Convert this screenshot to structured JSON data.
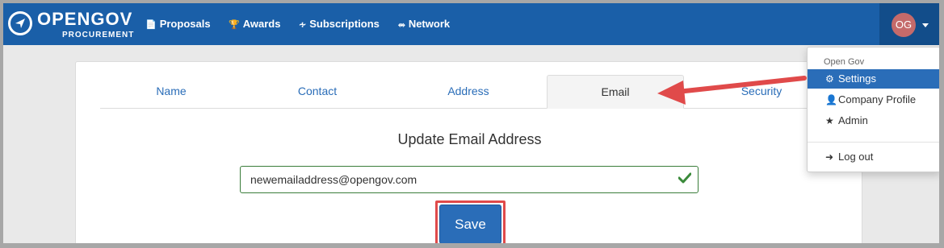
{
  "brand": {
    "title": "OPENGOV",
    "subtitle": "PROCUREMENT"
  },
  "nav": {
    "items": [
      {
        "label": "Proposals",
        "icon": "document-icon"
      },
      {
        "label": "Awards",
        "icon": "trophy-icon"
      },
      {
        "label": "Subscriptions",
        "icon": "rss-icon"
      },
      {
        "label": "Network",
        "icon": "share-icon"
      }
    ]
  },
  "user": {
    "initials": "OG"
  },
  "tabs": [
    {
      "label": "Name"
    },
    {
      "label": "Contact"
    },
    {
      "label": "Address"
    },
    {
      "label": "Email",
      "active": true
    },
    {
      "label": "Security"
    }
  ],
  "form": {
    "title": "Update Email Address",
    "email_value": "newemailaddress@opengov.com",
    "save_label": "Save"
  },
  "dropdown": {
    "header": "Open Gov",
    "items": [
      {
        "label": "Settings",
        "icon": "gear-icon",
        "active": true
      },
      {
        "label": "Company Profile",
        "icon": "user-icon"
      },
      {
        "label": "Admin",
        "icon": "star-icon"
      },
      {
        "label": "Log out",
        "icon": "logout-icon"
      }
    ]
  },
  "colors": {
    "navbar": "#1a5fa8",
    "accent": "#2a6db8",
    "valid": "#3a7d3a",
    "annotation": "#e04a4a"
  }
}
